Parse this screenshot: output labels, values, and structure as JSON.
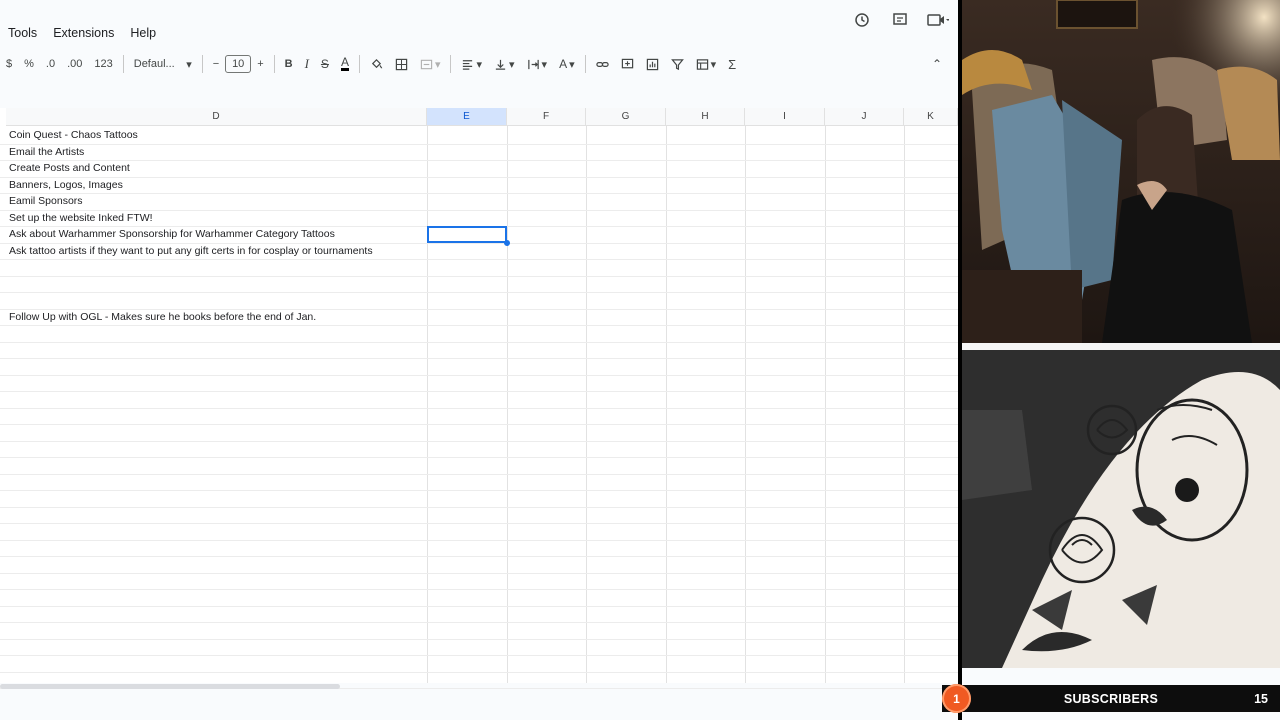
{
  "menu": [
    "Tools",
    "Extensions",
    "Help"
  ],
  "toolbar": {
    "currency": "$",
    "percent": "%",
    "dec_decrease": ".0",
    "dec_increase": ".00",
    "number_format": "123",
    "font": "Defaul...",
    "font_size": "10"
  },
  "grid": {
    "columns": [
      {
        "label": "D",
        "selected": false
      },
      {
        "label": "E",
        "selected": true
      },
      {
        "label": "F",
        "selected": false
      },
      {
        "label": "G",
        "selected": false
      },
      {
        "label": "H",
        "selected": false
      },
      {
        "label": "I",
        "selected": false
      },
      {
        "label": "J",
        "selected": false
      },
      {
        "label": "K",
        "selected": false
      }
    ],
    "rows": [
      "Coin Quest - Chaos Tattoos",
      "Email the Artists",
      "Create Posts and Content",
      "Banners, Logos, Images",
      "Eamil Sponsors",
      "Set up the website Inked FTW!",
      "Ask about Warhammer Sponsorship for Warhammer Category Tattoos",
      "Ask tattoo artists if they want to put any gift certs in for cosplay or tournaments",
      "",
      "",
      "",
      "Follow Up with OGL - Makes sure he books before the end of Jan."
    ],
    "selected_cell": "E7"
  },
  "overlay": {
    "subscriber_badge": "1",
    "subscriber_label": "SUBSCRIBERS",
    "subscriber_count": "15"
  }
}
